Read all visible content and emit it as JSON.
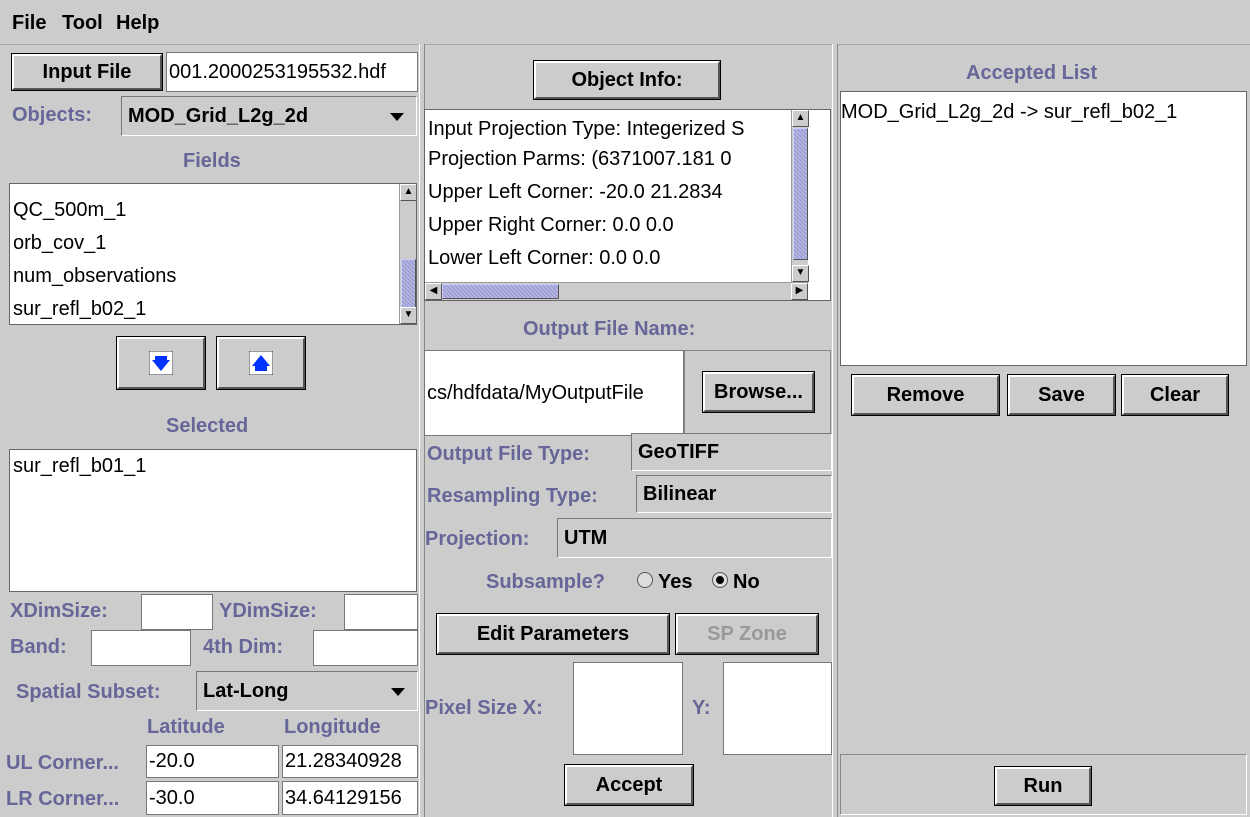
{
  "menu": [
    "File",
    "Tool",
    "Help"
  ],
  "left": {
    "input_file_button": "Input File",
    "input_file_value": "001.2000253195532.hdf",
    "objects_label": "Objects:",
    "objects_value": "MOD_Grid_L2g_2d",
    "fields_label": "Fields",
    "fields": [
      "QC_500m_1",
      "orb_cov_1",
      "num_observations",
      "sur_refl_b02_1"
    ],
    "selected_label": "Selected",
    "selected_items": [
      "sur_refl_b01_1"
    ],
    "xdim_label": "XDimSize:",
    "ydim_label": "YDimSize:",
    "band_label": "Band:",
    "fourth_dim_label": "4th Dim:",
    "spatial_subset_label": "Spatial Subset:",
    "spatial_subset_value": "Lat-Long",
    "latitude_label": "Latitude",
    "longitude_label": "Longitude",
    "ul_corner_label": "UL Corner...",
    "ul_lat": "-20.0",
    "ul_lon": "21.28340928",
    "lr_corner_label": "LR Corner...",
    "lr_lat": "-30.0",
    "lr_lon": "34.64129156"
  },
  "middle": {
    "object_info_button": "Object Info:",
    "info_lines": [
      "Input Projection Type:  Integerized S",
      "Projection Parms:  (6371007.181   0",
      "Upper Left Corner:  -20.0    21.2834",
      "Upper Right Corner:  0.0    0.0",
      "Lower Left Corner:  0.0    0.0"
    ],
    "output_file_name_label": "Output File Name:",
    "output_file_value": "cs/hdfdata/MyOutputFile",
    "browse_button": "Browse...",
    "output_type_label": "Output File Type:",
    "output_type_value": "GeoTIFF",
    "resampling_label": "Resampling Type:",
    "resampling_value": "Bilinear",
    "projection_label": "Projection:",
    "projection_value": "UTM",
    "subsample_label": "Subsample?",
    "yes_label": "Yes",
    "no_label": "No",
    "subsample_selected": "No",
    "edit_params_button": "Edit Parameters",
    "sp_zone_button": "SP Zone",
    "pixel_size_x_label": "Pixel Size X:",
    "pixel_size_y_label": "Y:",
    "accept_button": "Accept"
  },
  "right": {
    "accepted_list_label": "Accepted List",
    "accepted_items": [
      "MOD_Grid_L2g_2d -> sur_refl_b02_1"
    ],
    "remove_button": "Remove",
    "save_button": "Save",
    "clear_button": "Clear",
    "run_button": "Run"
  }
}
